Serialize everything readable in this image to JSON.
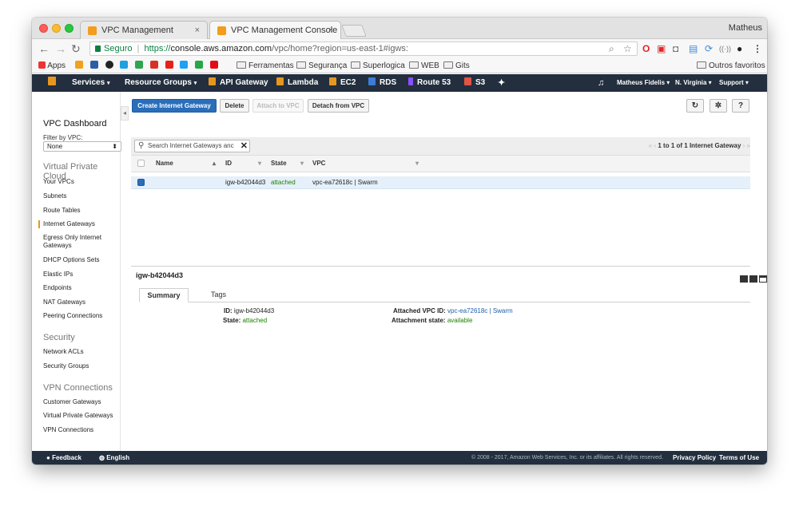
{
  "browser": {
    "tabs": [
      {
        "title": "VPC Management Console",
        "close": "×"
      },
      {
        "title": "VPC Management Console",
        "close": "×"
      }
    ],
    "user": "Matheus",
    "secure_label": "Seguro",
    "url_prefix": "https://",
    "url_host": "console.aws.amazon.com",
    "url_path": "/vpc/home?region=us-east-1#igws:",
    "bookmarks": {
      "apps": "Apps",
      "folders": [
        "Ferramentas",
        "Segurança",
        "Superlogica",
        "WEB",
        "Gits"
      ],
      "other": "Outros favoritos"
    }
  },
  "awsnav": {
    "services": "Services",
    "resource_groups": "Resource Groups",
    "shortcuts": [
      "API Gateway",
      "Lambda",
      "EC2",
      "RDS",
      "Route 53",
      "S3"
    ],
    "account": "Matheus Fidelis",
    "region": "N. Virginia",
    "support": "Support"
  },
  "sidebar": {
    "title": "VPC Dashboard",
    "filter_label": "Filter by VPC:",
    "filter_value": "None",
    "sections": [
      {
        "title": "Virtual Private Cloud",
        "items": [
          "Your VPCs",
          "Subnets",
          "Route Tables",
          "Internet Gateways",
          "Egress Only Internet Gateways",
          "DHCP Options Sets",
          "Elastic IPs",
          "Endpoints",
          "NAT Gateways",
          "Peering Connections"
        ]
      },
      {
        "title": "Security",
        "items": [
          "Network ACLs",
          "Security Groups"
        ]
      },
      {
        "title": "VPN Connections",
        "items": [
          "Customer Gateways",
          "Virtual Private Gateways",
          "VPN Connections"
        ]
      }
    ],
    "active_item": "Internet Gateways"
  },
  "toolbar": {
    "create": "Create Internet Gateway",
    "delete": "Delete",
    "attach": "Attach to VPC",
    "detach": "Detach from VPC"
  },
  "search": {
    "placeholder": "Search Internet Gateways and their properties",
    "value": "Search Internet Gateways anc"
  },
  "pager": "1 to 1 of 1 Internet Gateway",
  "table": {
    "headers": [
      "Name",
      "ID",
      "State",
      "VPC"
    ],
    "rows": [
      {
        "name": "",
        "id": "igw-b42044d3",
        "state": "attached",
        "vpc": "vpc-ea72618c | Swarm"
      }
    ]
  },
  "details": {
    "title": "igw-b42044d3",
    "tabs": [
      "Summary",
      "Tags"
    ],
    "fields": {
      "id_label": "ID:",
      "id_value": "igw-b42044d3",
      "state_label": "State:",
      "state_value": "attached",
      "vpc_label": "Attached VPC ID:",
      "vpc_value": "vpc-ea72618c | Swarm",
      "attach_state_label": "Attachment state:",
      "attach_state_value": "available"
    }
  },
  "footer": {
    "feedback": "Feedback",
    "language": "English",
    "copyright": "© 2008 - 2017, Amazon Web Services, Inc. or its affiliates. All rights reserved.",
    "privacy": "Privacy Policy",
    "terms": "Terms of Use"
  },
  "colors": {
    "aws_nav": "#232f3e",
    "primary": "#2a6ebb",
    "accent": "#e7971e",
    "attached": "#1d8102"
  }
}
